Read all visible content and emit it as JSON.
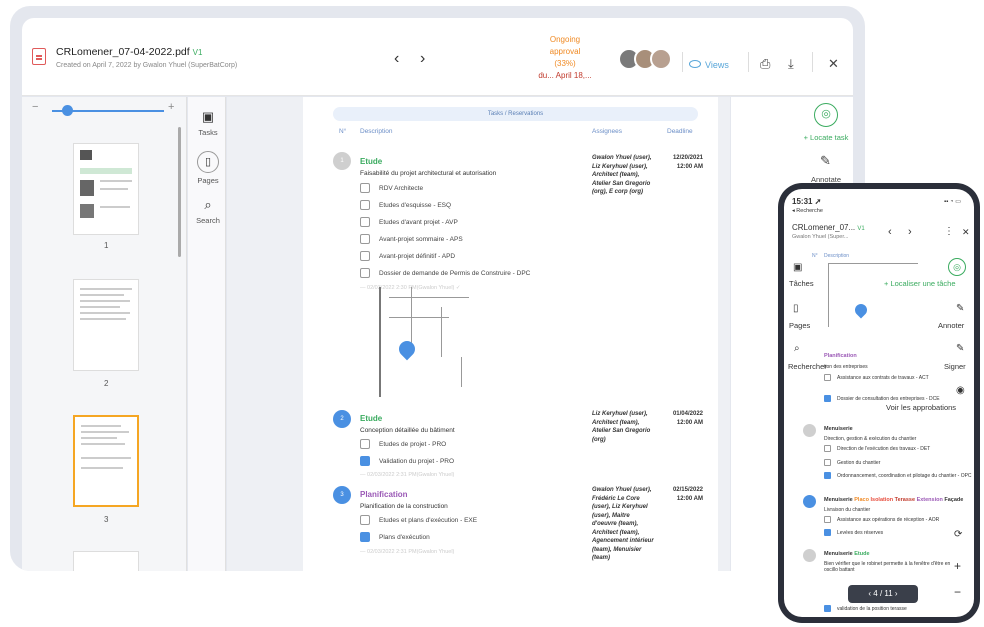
{
  "desktop": {
    "file_name": "CRLomener_07-04-2022.pdf",
    "version": "V1",
    "created": "Created on April 7, 2022 by Gwalon Yhuel (SuperBatCorp)",
    "nav_prev": "‹",
    "nav_next": "›",
    "status": {
      "l1": "Ongoing",
      "l2": "approval",
      "l3": "(33%)",
      "due": "du... April 18,..."
    },
    "views_label": "Views",
    "sidebar": [
      {
        "label": "Tasks",
        "icon": "clipboard-icon"
      },
      {
        "label": "Pages",
        "icon": "book-icon"
      },
      {
        "label": "Search",
        "icon": "search-icon"
      }
    ],
    "thumbnails": [
      "1",
      "2",
      "3"
    ],
    "table": {
      "header": "Tasks / Reservations",
      "columns": [
        "N°",
        "Description",
        "Assignees",
        "Deadline"
      ],
      "rows": [
        {
          "num": "1",
          "title": "Etude",
          "subtitle": "Faisabilité du projet architectural et autorisation",
          "items": [
            {
              "label": "RDV Architecte",
              "checked": false
            },
            {
              "label": "Etudes d'esquisse - ESQ",
              "checked": false
            },
            {
              "label": "Etudes d'avant projet - AVP",
              "checked": false
            },
            {
              "label": "Avant-projet sommaire - APS",
              "checked": false
            },
            {
              "label": "Avant-projet définitif - APD",
              "checked": false
            },
            {
              "label": "Dossier de demande de Permis de Construire - DPC",
              "checked": false
            }
          ],
          "stamp": "— 02/03/2022 2:30 PM(Gwalon Yhuel) ✓",
          "assignees": "Gwalon Yhuel (user), Liz Keryhuel (user), Architect (team), Atelier San Gregorio (org), E corp (org)",
          "deadline": "12/20/2021 12:00 AM"
        },
        {
          "num": "2",
          "title": "Etude",
          "subtitle": "Conception détaillée du bâtiment",
          "items": [
            {
              "label": "Etudes de projet - PRO",
              "checked": false
            },
            {
              "label": "Validation du projet - PRO",
              "checked": true
            }
          ],
          "stamp": "— 02/03/2022 2:31 PM(Gwalon Yhuel)",
          "assignees": "Liz Keryhuel (user), Architect (team), Atelier San Gregorio (org)",
          "deadline": "01/04/2022 12:00 AM"
        },
        {
          "num": "3",
          "title": "Planification",
          "subtitle": "Planification de la construction",
          "items": [
            {
              "label": "Etudes et plans d'exécution - EXE",
              "checked": false
            },
            {
              "label": "Plans d'exécution",
              "checked": true
            }
          ],
          "stamp": "— 02/03/2022 2:31 PM(Gwalon Yhuel)",
          "assignees": "Gwalon Yhuel (user), Frédéric Le Core (user), Liz Keryhuel (user), Maitre d'oeuvre (team), Architect (team), Agencement intérieur (team), Menuisier (team)",
          "deadline": "02/15/2022 12:00 AM"
        }
      ]
    },
    "right_panel": {
      "locate": "+ Locate task",
      "annotate": "Annotate"
    }
  },
  "mobile": {
    "time": "15:31 ➚",
    "back": "◂ Recherche",
    "file_name": "CRLomener_07...",
    "version": "V1",
    "owner": "Gwalon Yhuel (Super...",
    "col_num": "N°",
    "col_desc": "Description",
    "left_labels": [
      "Tâches",
      "Pages",
      "Rechercher"
    ],
    "right_labels": [
      "+ Localiser une tâche",
      "Annoter",
      "Signer",
      "Voir les approbations"
    ],
    "section1": {
      "title": "Planification",
      "sub": "tion des entreprises",
      "items": [
        "Assistance aux contrats de travaux - ACT",
        "Dossier de consultation des entreprises - DCE"
      ]
    },
    "section2": {
      "title": "Menuiserie",
      "sub": "Direction, gestion & exécution du chantier",
      "items": [
        "Direction de l'exécution des travaux - DET",
        "Gestion du chantier",
        "Ordonnancement, coordination et pilotage du chantier - OPC"
      ]
    },
    "section3": {
      "tags": [
        "Menuiserie",
        "Placo",
        "Isolation",
        "Terasse",
        "Extension",
        "Façade"
      ],
      "sub": "Livraison du chantier",
      "items": [
        "Assistance aux opérations de réception - AOR",
        "Levées des réserves"
      ]
    },
    "section4": {
      "title": "Menuiserie",
      "tag": "Etude",
      "text": "Bien vérifier que le robinet permette à la fenêtre d'être en oscillo battant",
      "item": "validation de la position terasse"
    },
    "pager": "‹   4 / 11   ›"
  }
}
